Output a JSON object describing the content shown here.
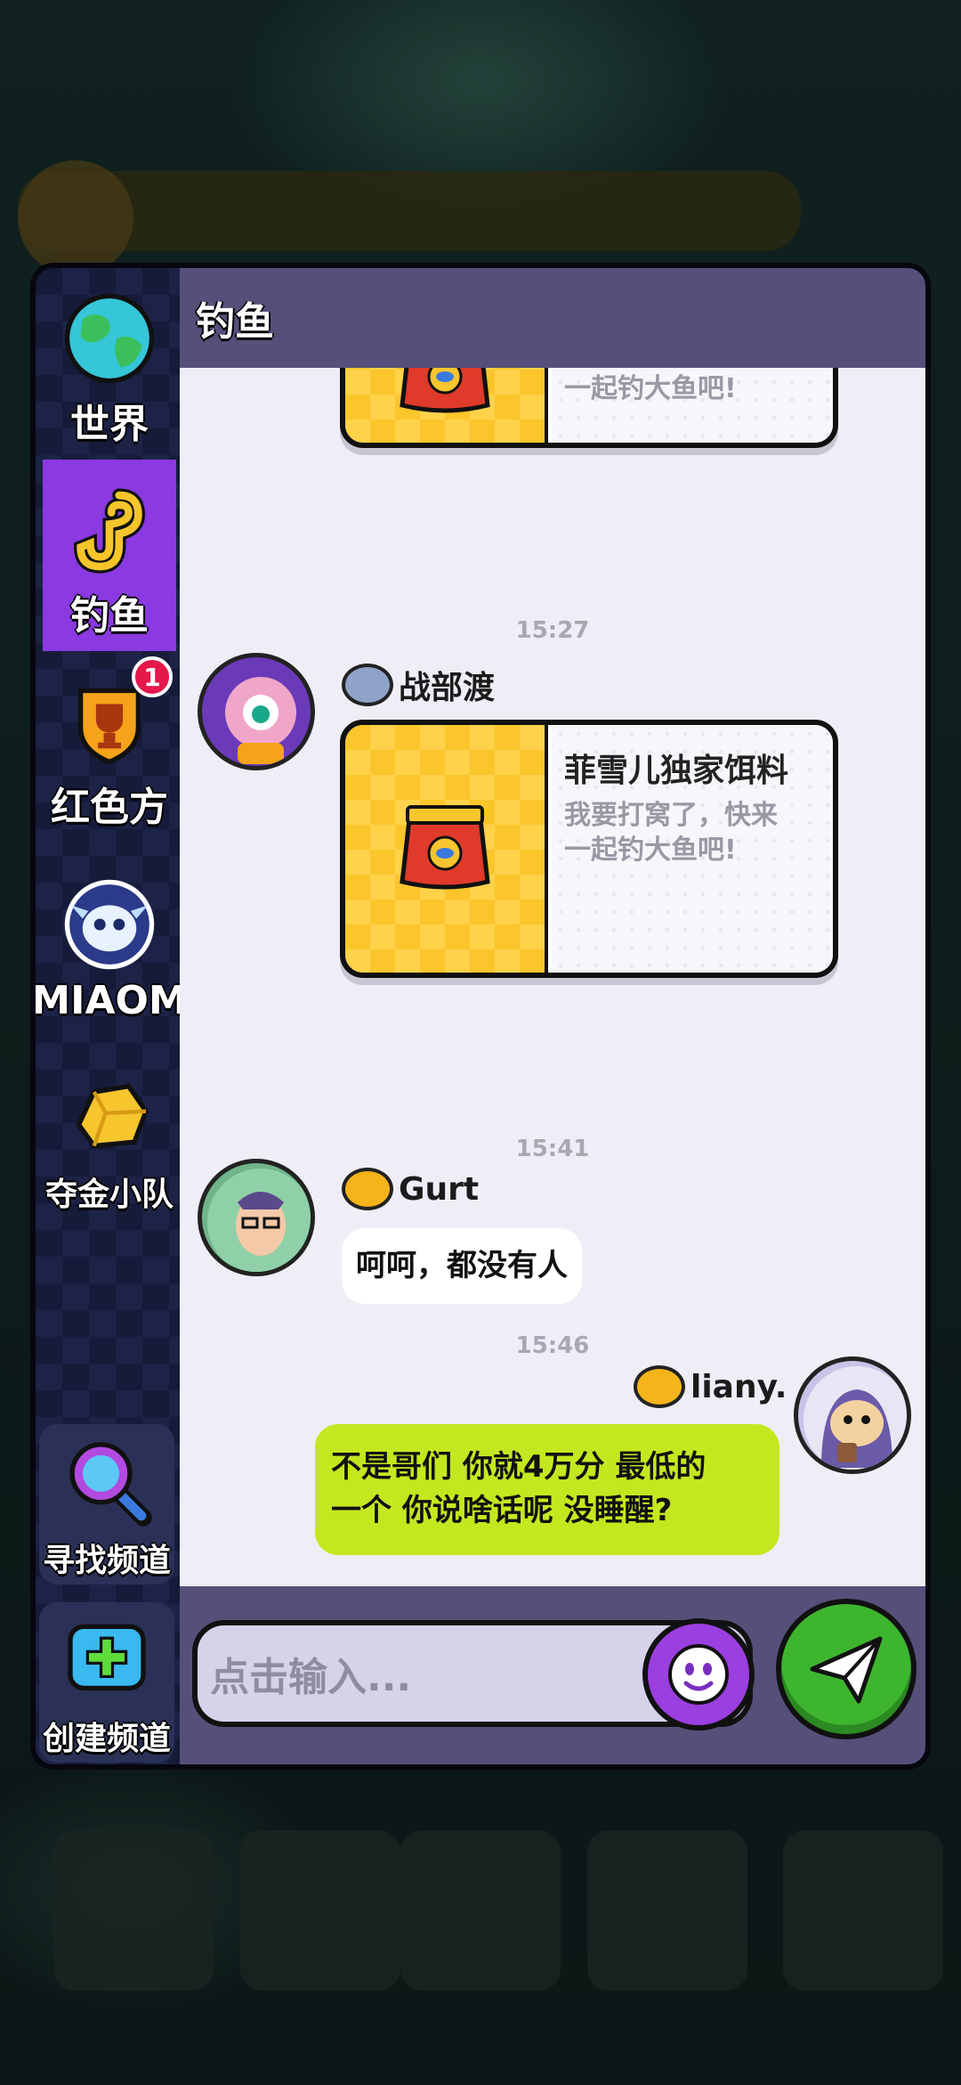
{
  "sidebar": {
    "items": [
      {
        "label": "世界",
        "icon": "globe-icon"
      },
      {
        "label": "钓鱼",
        "icon": "fishing-hook-icon",
        "active": true
      },
      {
        "label": "红色方",
        "icon": "trophy-shield-icon",
        "badge": "1"
      },
      {
        "label": "MIAOM",
        "icon": "ghost-avatar-icon"
      },
      {
        "label": "夺金小队",
        "icon": "gold-nugget-icon"
      }
    ],
    "find_channel_label": "寻找频道",
    "create_channel_label": "创建频道"
  },
  "header": {
    "title": "钓鱼"
  },
  "messages": {
    "card_top": {
      "desc": "一起钓大鱼吧!"
    },
    "time_1": "15:27",
    "msg_1": {
      "user": "战部渡",
      "card_title": "菲雪儿独家饵料",
      "card_desc_line1": "我要打窝了，快来",
      "card_desc_line2": "一起钓大鱼吧!"
    },
    "time_2": "15:41",
    "msg_2": {
      "user": "Gurt",
      "text": "呵呵，都没有人"
    },
    "time_3": "15:46",
    "msg_3": {
      "user": "liany.",
      "text_line1": "不是哥们 你就4万分 最低的",
      "text_line2": "一个 你说啥话呢 没睡醒?"
    }
  },
  "input": {
    "placeholder": "点击输入..."
  },
  "colors": {
    "accent_purple": "#8a3ae0",
    "own_bubble": "#c4e81f",
    "send_green": "#3eb52f",
    "header": "#55507a"
  }
}
